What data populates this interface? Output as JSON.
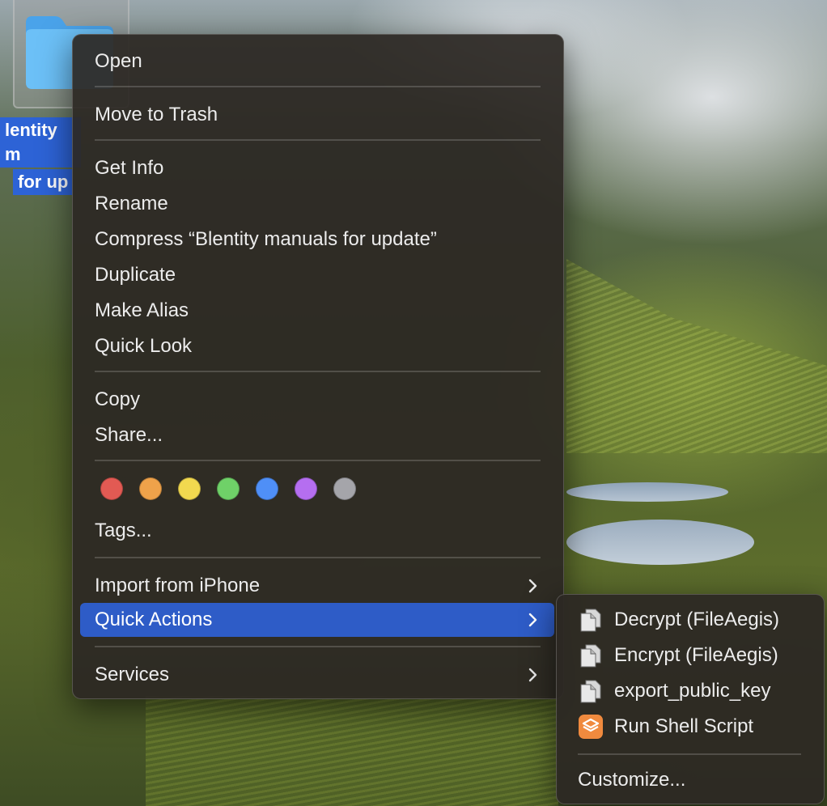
{
  "desktop": {
    "folder": {
      "label_line1": "lentity m",
      "label_line2": "for up"
    }
  },
  "context_menu": {
    "open": "Open",
    "move_to_trash": "Move to Trash",
    "get_info": "Get Info",
    "rename": "Rename",
    "compress": "Compress “Blentity manuals for update”",
    "duplicate": "Duplicate",
    "make_alias": "Make Alias",
    "quick_look": "Quick Look",
    "copy": "Copy",
    "share": "Share...",
    "tag_colors": [
      "#e25a53",
      "#efa24a",
      "#f2d94f",
      "#6fd168",
      "#4f8ff7",
      "#b56ef0",
      "#a5a5aa"
    ],
    "tags": "Tags...",
    "import_from_iphone": "Import from iPhone",
    "quick_actions": "Quick Actions",
    "services": "Services",
    "selected_item": "Quick Actions"
  },
  "quick_actions_submenu": {
    "decrypt": "Decrypt (FileAegis)",
    "encrypt": "Encrypt (FileAegis)",
    "export_public_key": "export_public_key",
    "run_shell_script": "Run Shell Script",
    "customize": "Customize..."
  },
  "colors": {
    "selection": "#2e5cc7",
    "menu_bg": "#2c2824",
    "folder_blue": "#5bb4f5",
    "shortcuts_orange": "#f08a3e"
  }
}
